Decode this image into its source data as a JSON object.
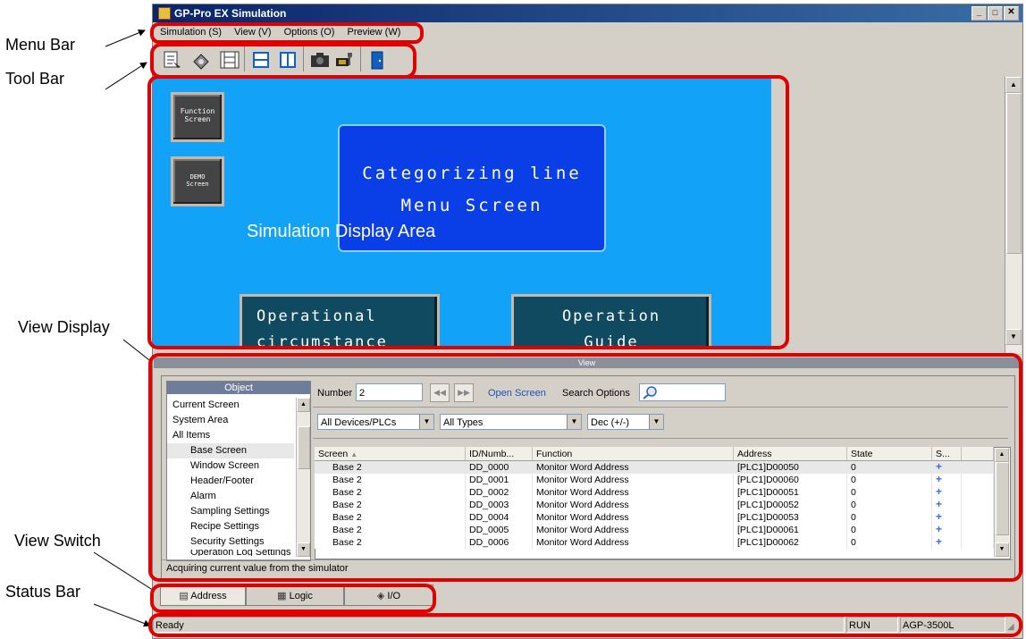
{
  "callouts": {
    "menu_bar": "Menu Bar",
    "tool_bar": "Tool Bar",
    "view_display": "View Display",
    "view_switch": "View Switch",
    "status_bar": "Status Bar",
    "sim_area": "Simulation Display Area"
  },
  "window": {
    "title": "GP-Pro EX Simulation"
  },
  "menu": [
    "Simulation (S)",
    "View (V)",
    "Options (O)",
    "Preview (W)"
  ],
  "toolbar_icons": [
    "address-icon",
    "io-icon",
    "logic-icon",
    "split-horizontal-icon",
    "split-vertical-icon",
    "camera-icon",
    "device-tool-icon",
    "exit-icon"
  ],
  "sim": {
    "btn_function": [
      "Function",
      "Screen"
    ],
    "btn_demo": [
      "DEMO",
      "Screen"
    ],
    "main_title": [
      "Categorizing line",
      "Menu Screen"
    ],
    "btn_operational": [
      "Operational",
      "circumstance"
    ],
    "btn_guide": [
      "Operation",
      "Guide"
    ]
  },
  "view": {
    "header": "View",
    "object_header": "Object",
    "object_items": [
      "Current Screen",
      "System Area",
      "All Items"
    ],
    "object_subitems": [
      "Base Screen",
      "Window Screen",
      "Header/Footer",
      "Alarm",
      "Sampling Settings",
      "Recipe Settings",
      "Security Settings",
      "Operation Log Settings"
    ],
    "number_label": "Number",
    "number_value": "2",
    "open_screen": "Open Screen",
    "search_options": "Search Options",
    "filter_devices": "All Devices/PLCs",
    "filter_types": "All Types",
    "filter_format": "Dec (+/-)",
    "columns": [
      "Screen",
      "ID/Numb...",
      "Function",
      "Address",
      "State",
      "S..."
    ],
    "rows": [
      [
        "Base 2",
        "DD_0000",
        "Monitor Word Address",
        "[PLC1]D00050",
        "0"
      ],
      [
        "Base 2",
        "DD_0001",
        "Monitor Word Address",
        "[PLC1]D00060",
        "0"
      ],
      [
        "Base 2",
        "DD_0002",
        "Monitor Word Address",
        "[PLC1]D00051",
        "0"
      ],
      [
        "Base 2",
        "DD_0003",
        "Monitor Word Address",
        "[PLC1]D00052",
        "0"
      ],
      [
        "Base 2",
        "DD_0004",
        "Monitor Word Address",
        "[PLC1]D00053",
        "0"
      ],
      [
        "Base 2",
        "DD_0005",
        "Monitor Word Address",
        "[PLC1]D00061",
        "0"
      ],
      [
        "Base 2",
        "DD_0006",
        "Monitor Word Address",
        "[PLC1]D00062",
        "0"
      ]
    ],
    "status_msg": "Acquiring current value from the simulator"
  },
  "tabs": [
    "Address",
    "Logic",
    "I/O"
  ],
  "status": {
    "left": "Ready",
    "mode": "RUN",
    "model": "AGP-3500L"
  },
  "colors": {
    "highlight": "#e00000",
    "sim_bg": "#12a2f8",
    "title_btn": "#0a3fe8",
    "teal_btn": "#0f4a60"
  }
}
